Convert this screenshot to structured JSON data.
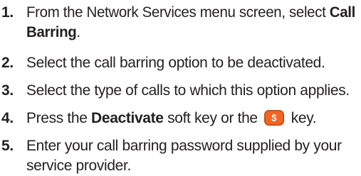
{
  "steps": [
    {
      "number": "1.",
      "text_before": "From the Network Services menu screen, select ",
      "bold": "Call",
      "line2_bold": "Barring",
      "line2_after": "."
    },
    {
      "number": "2.",
      "text": "Select the call barring option to be deactivated."
    },
    {
      "number": "3.",
      "text": "Select the type of calls to which this option applies."
    },
    {
      "number": "4.",
      "text_before": "Press the ",
      "bold": "Deactivate",
      "text_middle": " soft key or the ",
      "icon": "orange-soft-key-icon",
      "text_after": " key."
    },
    {
      "number": "5.",
      "line1": "Enter your call barring password supplied by your",
      "line2": "service provider."
    }
  ],
  "colors": {
    "text": "#231f20",
    "key_fill": "#f26522",
    "key_symbol": "#ffffff"
  }
}
